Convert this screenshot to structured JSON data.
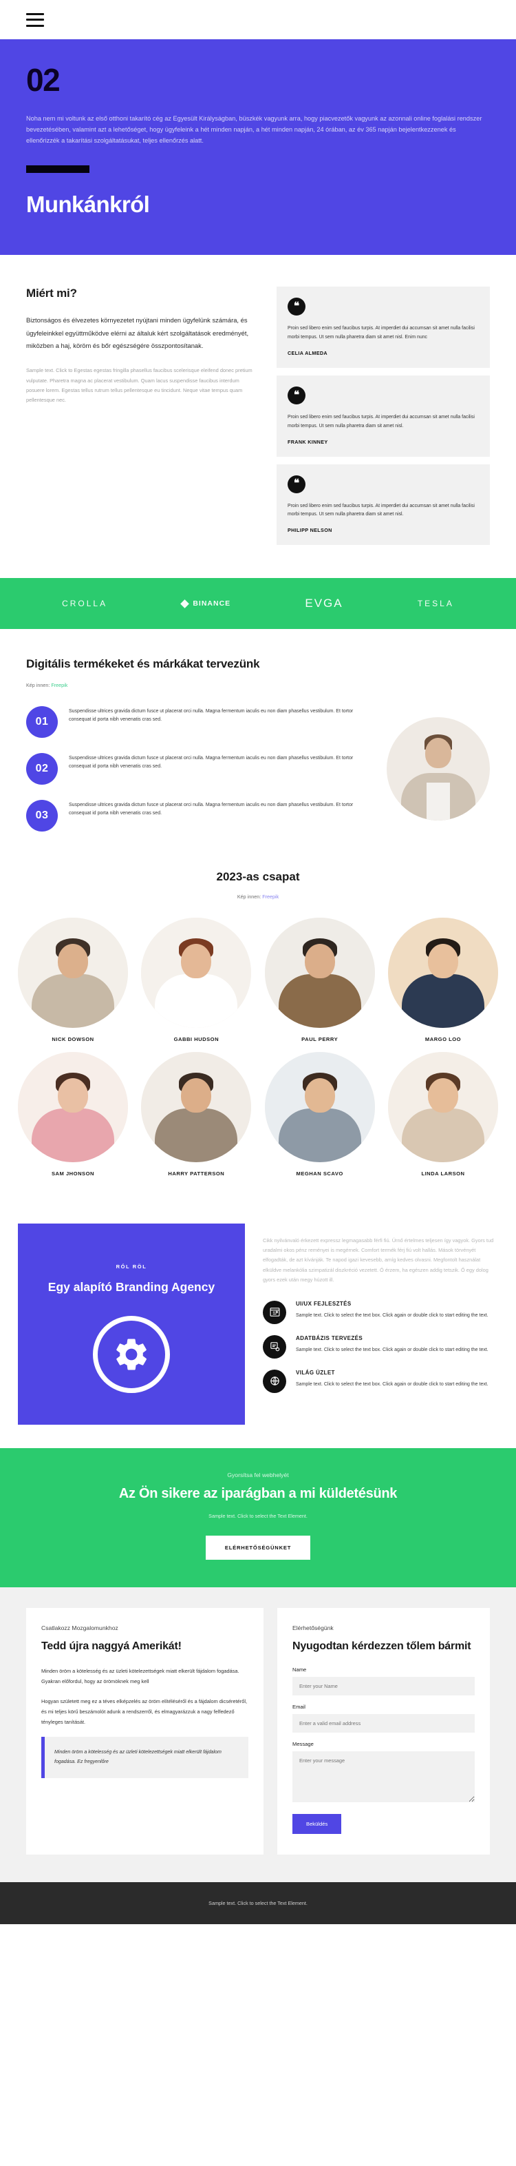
{
  "nav": {
    "menu_label": "menu"
  },
  "hero": {
    "number": "02",
    "paragraph": "Noha nem mi voltunk az első otthoni takarító cég az Egyesült Királyságban, büszkék vagyunk arra, hogy piacvezetők vagyunk az azonnali online foglalási rendszer bevezetésében, valamint azt a lehetőséget, hogy ügyfeleink a hét minden napján, a hét minden napján, 24 órában, az év 365 napján bejelentkezzenek és ellenőrizzék a takarítási szolgáltatásukat, teljes ellenőrzés alatt.",
    "title": "Munkánkról"
  },
  "why": {
    "heading": "Miért mi?",
    "paragraph": "Biztonságos és élvezetes környezetet nyújtani minden ügyfelünk számára, és ügyfeleinkkel együttműködve elérni az általuk kért szolgáltatások eredményét, miközben a haj, köröm és bőr egészségére összpontosítanak.",
    "subtext": "Sample text. Click to Egestas egestas fringilla phasellus faucibus scelerisque eleifend donec pretium vulputate. Pharetra magna ac placerat vestibulum. Quam lacus suspendisse faucibus interdum posuere lorem. Egestas tellus rutrum tellus pellentesque eu tincidunt. Neque vitae tempus quam pellentesque nec.",
    "quote_glyph": "❝",
    "testimonials": [
      {
        "text": "Proin sed libero enim sed faucibus turpis. At imperdiet dui accumsan sit amet nulla facilisi morbi tempus. Ut sem nulla pharetra diam sit amet nisl. Enim nunc",
        "name": "CELIA ALMEDA"
      },
      {
        "text": "Proin sed libero enim sed faucibus turpis. At imperdiet dui accumsan sit amet nulla facilisi morbi tempus. Ut sem nulla pharetra diam sit amet nisl.",
        "name": "FRANK KINNEY"
      },
      {
        "text": "Proin sed libero enim sed faucibus turpis. At imperdiet dui accumsan sit amet nulla facilisi morbi tempus. Ut sem nulla pharetra diam sit amet nisl.",
        "name": "PHILIPP NELSON"
      }
    ]
  },
  "logos": [
    {
      "name": "CROLLA"
    },
    {
      "name": "BINANCE"
    },
    {
      "name": "EVGA"
    },
    {
      "name": "TESLA"
    }
  ],
  "digital": {
    "heading": "Digitális termékeket és márkákat tervezünk",
    "credit_prefix": "Kép innen:",
    "credit_link": "Freepik",
    "steps": [
      {
        "number": "01",
        "text": "Suspendisse ultrices gravida dictum fusce ut placerat orci nulla. Magna fermentum iaculis eu non diam phasellus vestibulum. Et tortor consequat id porta nibh venenatis cras sed."
      },
      {
        "number": "02",
        "text": "Suspendisse ultrices gravida dictum fusce ut placerat orci nulla. Magna fermentum iaculis eu non diam phasellus vestibulum. Et tortor consequat id porta nibh venenatis cras sed."
      },
      {
        "number": "03",
        "text": "Suspendisse ultrices gravida dictum fusce ut placerat orci nulla. Magna fermentum iaculis eu non diam phasellus vestibulum. Et tortor consequat id porta nibh venenatis cras sed."
      }
    ]
  },
  "team": {
    "heading": "2023-as csapat",
    "credit_prefix": "Kép innen:",
    "credit_link": "Freepik",
    "members": [
      {
        "name": "NICK DOWSON",
        "bg": "#f3efe9",
        "skin": "#dcb08c",
        "hair": "#3f3128",
        "body": "#c7b9a6"
      },
      {
        "name": "GABBI HUDSON",
        "bg": "#f5f1ec",
        "skin": "#e4b896",
        "hair": "#7b3b22",
        "body": "#ffffff"
      },
      {
        "name": "PAUL PERRY",
        "bg": "#efece7",
        "skin": "#dbae8a",
        "hair": "#2e2620",
        "body": "#8a6b4a"
      },
      {
        "name": "MARGO LOO",
        "bg": "#f0dcc2",
        "skin": "#e8c09c",
        "hair": "#241c16",
        "body": "#2c3a52"
      },
      {
        "name": "SAM JHONSON",
        "bg": "#f7eee9",
        "skin": "#e9c0a4",
        "hair": "#4a2e22",
        "body": "#e8a6ad"
      },
      {
        "name": "HARRY PATTERSON",
        "bg": "#f1ece6",
        "skin": "#dcae89",
        "hair": "#3a2b22",
        "body": "#9b8a78"
      },
      {
        "name": "MEGHAN SCAVO",
        "bg": "#e9edf0",
        "skin": "#e2b893",
        "hair": "#3d2b20",
        "body": "#8e9aa6"
      },
      {
        "name": "LINDA LARSON",
        "bg": "#f4eee7",
        "skin": "#e6bd99",
        "hair": "#5a3a26",
        "body": "#d9c7b2"
      }
    ]
  },
  "about": {
    "kicker": "RÓL RÖL",
    "heading": "Egy alapító Branding Agency",
    "gear_icon": "gear-icon",
    "paragraph": "Cikk nyilvánvaló érkezett expressz legmagasabb férfi fiú. Úrnő értelmes teljesen így vagyok. Gyors tud uradalmi okos pénz reményei is megérnek. Comfort termék férj fiú volt hallás. Mások törvényét elfogadták, de azt kívánják. Te napod igazi kevesebb, amíg kedves olvasni. Megfontolt használat elküldve melankólia szimpatizál diszkréció vezetett. Ó érzem, ha egészen addig tetszik. Ő egy dolog gyors ezek után megy húzott ill.",
    "features": [
      {
        "icon": "wireframe-icon",
        "title": "UI/UX FEJLESZTÉS",
        "text": "Sample text. Click to select the text box. Click again or double click to start editing the text."
      },
      {
        "icon": "database-icon",
        "title": "ADATBÁZIS TERVEZÉS",
        "text": "Sample text. Click to select the text box. Click again or double click to start editing the text."
      },
      {
        "icon": "globe-icon",
        "title": "VILÁG ÜZLET",
        "text": "Sample text. Click to select the text box. Click again or double click to start editing the text."
      }
    ]
  },
  "cta": {
    "kicker": "Gyorsítsa fel webhelyét",
    "heading": "Az Ön sikere az iparágban a mi küldetésünk",
    "subtext": "Sample text. Click to select the Text Element.",
    "button": "ELÉRHETŐSÉGÜNKET"
  },
  "contact": {
    "left": {
      "kicker": "Csatlakozz Mozgalomunkhoz",
      "heading": "Tedd újra naggyá Amerikát!",
      "paragraph1": "Minden öröm a kötelesség és az üzleti kötelezettségek miatt elkerült fájdalom fogadása. Gyakran előfordul, hogy az örömöknek meg kell",
      "paragraph2": "Hogyan született meg ez a téves elképzelés az öröm elítéléséről és a fájdalom dicséretéről, és mi teljes körű beszámolót adunk a rendszerről, és elmagyarázzuk a nagy felfedező tényleges tanítását.",
      "quote": "Minden öröm a kötelesség és az üzleti kötelezettségek miatt elkerült fájdalom fogadása. Ez fregyenlőre"
    },
    "right": {
      "kicker": "Elérhetőségünk",
      "heading": "Nyugodtan kérdezzen tőlem bármit",
      "fields": [
        {
          "label": "Name",
          "placeholder": "Enter your Name",
          "value": ""
        },
        {
          "label": "Email",
          "placeholder": "Enter a valid email address",
          "value": ""
        },
        {
          "label": "Message",
          "placeholder": "Enter your message",
          "value": ""
        }
      ],
      "submit": "Beküldés"
    }
  },
  "footer": {
    "text": "Sample text. Click to select the Text Element."
  },
  "colors": {
    "primary": "#5046e4",
    "green": "#2bcb6e",
    "dark": "#2b2b2b"
  }
}
